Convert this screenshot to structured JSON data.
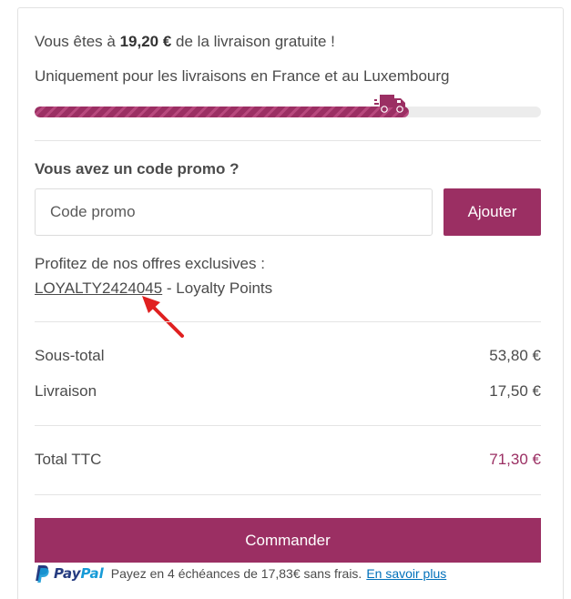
{
  "shipping": {
    "free_prefix": "Vous êtes à ",
    "free_amount": "19,20 €",
    "free_suffix": " de la livraison gratuite !",
    "restriction": "Uniquement pour les livraisons en France et au Luxembourg",
    "progress_fraction": 0.74
  },
  "promo": {
    "title": "Vous avez un code promo ?",
    "placeholder": "Code promo",
    "value": "",
    "button_label": "Ajouter"
  },
  "offers": {
    "intro": "Profitez de nos offres exclusives :",
    "code": "LOYALTY2424045",
    "code_suffix": " - Loyalty Points"
  },
  "summary": {
    "subtotal_label": "Sous-total",
    "subtotal_value": "53,80 €",
    "shipping_label": "Livraison",
    "shipping_value": "17,50 €",
    "total_label": "Total TTC",
    "total_value": "71,30 €"
  },
  "checkout": {
    "order_label": "Commander"
  },
  "paypal": {
    "brand_pay": "Pay",
    "brand_pal": "Pal",
    "message": "Payez en 4 échéances de 17,83€ sans frais.",
    "link_label": "En savoir plus"
  },
  "colors": {
    "accent": "#9b2f63",
    "paypal_dark": "#253b80",
    "paypal_light": "#179bd7",
    "annotation_arrow": "#e02020"
  },
  "icons": {
    "truck": "delivery-truck-icon",
    "paypal": "paypal-logo-icon",
    "annotation": "red-arrow-annotation"
  }
}
